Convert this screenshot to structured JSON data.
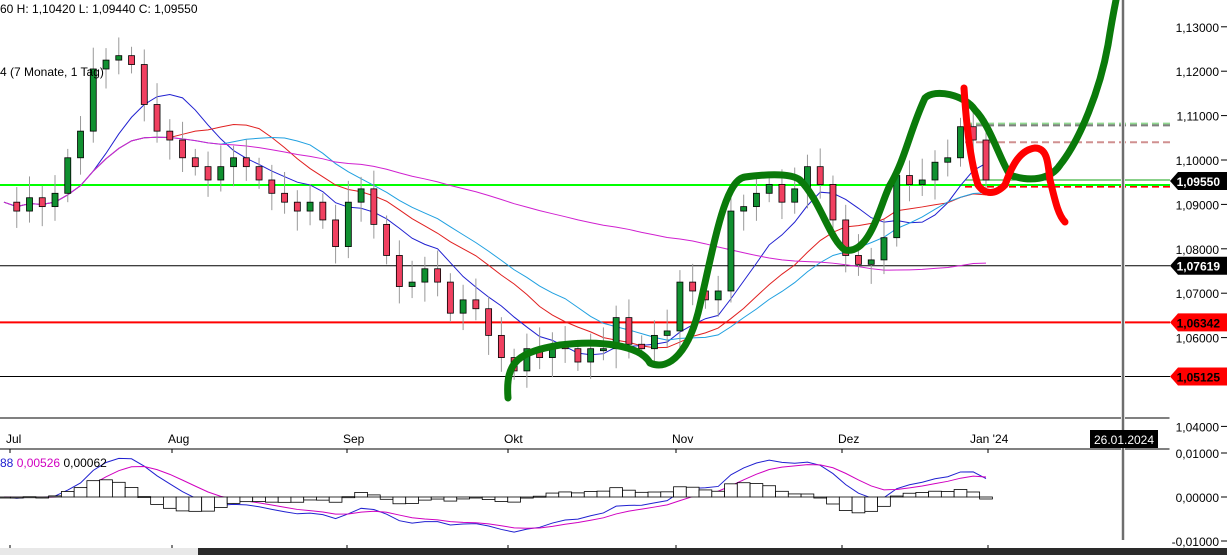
{
  "header": {
    "ohlc": "60  H: 1,10420  L: 1,09440  C: 1,09550",
    "range": "4   (7 Monate, 1 Tag)"
  },
  "macd_panel": {
    "values": [
      {
        "text": "88",
        "color": "#2020d0"
      },
      {
        "text": "0,00526",
        "color": "#d000c0"
      },
      {
        "text": "0,00062",
        "color": "#000000"
      }
    ]
  },
  "crosshair": {
    "date_label": "26.01.2024"
  },
  "chart_data": {
    "type": "candlestick",
    "x_ticks": [
      "Jul",
      "Aug",
      "Sep",
      "Okt",
      "Nov",
      "Dez",
      "Jan '24"
    ],
    "y_ticks": [
      "1,13000",
      "1,12000",
      "1,11000",
      "1,10000",
      "1,09000",
      "1,08000",
      "1,07000",
      "1,06000",
      "1,04000"
    ],
    "y_tick_values": [
      1.13,
      1.12,
      1.11,
      1.1,
      1.09,
      1.08,
      1.07,
      1.06,
      1.04
    ],
    "ylim": [
      1.036,
      1.136
    ],
    "macd_y_ticks": [
      "0,01000",
      "0,00000",
      "-0,01000"
    ],
    "macd_y_tick_values": [
      0.01,
      0.0,
      -0.01
    ],
    "closes": [
      1.0905,
      1.0885,
      1.0915,
      1.0895,
      1.0925,
      1.1005,
      1.1065,
      1.1205,
      1.1225,
      1.1235,
      1.1215,
      1.1125,
      1.1065,
      1.1045,
      1.1005,
      1.0985,
      1.0955,
      1.0985,
      1.1005,
      1.0985,
      1.0955,
      1.0925,
      1.0905,
      1.0885,
      1.0905,
      1.0865,
      1.0805,
      1.0905,
      1.0935,
      1.0855,
      1.0785,
      1.0715,
      1.0725,
      1.0755,
      1.0725,
      1.0655,
      1.0685,
      1.0665,
      1.0605,
      1.0555,
      1.0525,
      1.0575,
      1.0555,
      1.0585,
      1.0575,
      1.0545,
      1.0575,
      1.0575,
      1.0645,
      1.0585,
      1.0575,
      1.0605,
      1.0615,
      1.0725,
      1.0705,
      1.0685,
      1.0705,
      1.0885,
      1.0895,
      1.0925,
      1.0945,
      1.0905,
      1.0935,
      1.0985,
      1.0945,
      1.0865,
      1.0785,
      1.0765,
      1.0775,
      1.0825,
      1.0965,
      1.0945,
      1.0955,
      1.0995,
      1.1005,
      1.1075,
      1.1045,
      1.0955
    ],
    "levels": [
      {
        "value": 1.0955,
        "label": "1,09550",
        "color": "#00ff00",
        "label_bg": "#000000",
        "label_color": "#ffffff"
      },
      {
        "value": 1.07619,
        "label": "1,07619",
        "color": "#000000",
        "label_bg": "#000000",
        "label_color": "#ffffff"
      },
      {
        "value": 1.06342,
        "label": "1,06342",
        "color": "#ff0000",
        "label_bg": "#ff0000",
        "label_color": "#000000"
      },
      {
        "value": 1.05125,
        "label": "1,05125",
        "color": "#000000",
        "label_bg": "#ff0000",
        "label_color": "#000000"
      }
    ],
    "dashed_levels": [
      {
        "value": 1.1082,
        "color": "#90d890"
      },
      {
        "value": 1.1078,
        "color": "#808080"
      },
      {
        "value": 1.104,
        "color": "#d09090"
      },
      {
        "value": 1.094,
        "color": "#ff0000"
      }
    ],
    "moving_averages": [
      {
        "period": 8,
        "color": "#2020d0"
      },
      {
        "period": 14,
        "color": "#e02020"
      },
      {
        "period": 18,
        "color": "#20a0e0"
      },
      {
        "period": 50,
        "color": "#d020d0"
      }
    ],
    "colors": {
      "up": "#109030",
      "down": "#f04060",
      "annotation_green": "#0a7a0a",
      "annotation_red": "#ff0000"
    }
  }
}
